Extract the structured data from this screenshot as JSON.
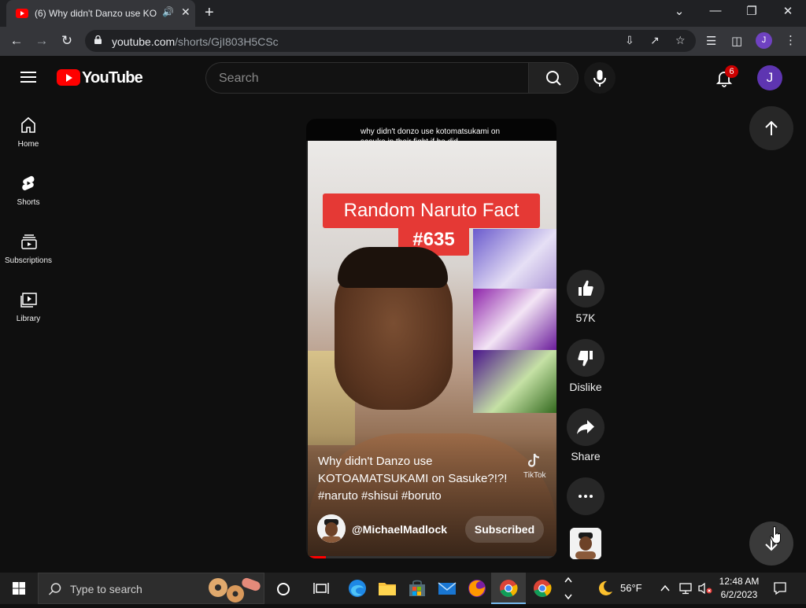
{
  "browser": {
    "tab_title": "(6) Why didn't Danzo use KO",
    "url_host": "youtube.com",
    "url_path": "/shorts/GjI803H5CSc",
    "profile_initial": "J"
  },
  "header": {
    "logo_text": "YouTube",
    "search_placeholder": "Search",
    "notification_count": "6",
    "avatar_initial": "J"
  },
  "sidebar": {
    "items": [
      {
        "label": "Home",
        "icon": "home-icon"
      },
      {
        "label": "Shorts",
        "icon": "shorts-icon"
      },
      {
        "label": "Subscriptions",
        "icon": "subscriptions-icon"
      },
      {
        "label": "Library",
        "icon": "library-icon"
      }
    ]
  },
  "video": {
    "top_caption": "why didn't donzo use kotomatsukami on sasuke in their fight if he did",
    "fact_line1": "Random Naruto Fact",
    "fact_line2": "#635",
    "title": "Why didn't Danzo use KOTOAMATSUKAMI on Sasuke?!?! #naruto #shisui #boruto",
    "watermark": "TikTok",
    "channel": "@MichaelMadlock",
    "subscribe_label": "Subscribed",
    "progress": 0.08
  },
  "actions": {
    "like_count": "57K",
    "dislike_label": "Dislike",
    "share_label": "Share"
  },
  "taskbar": {
    "search_text": "Type to search",
    "weather": "56°F",
    "time": "12:48 AM",
    "date": "6/2/2023"
  },
  "colors": {
    "yt_red": "#ff0000",
    "background": "#0f0f0f",
    "button_bg": "#272727",
    "accent_purple": "#5e35b1"
  }
}
